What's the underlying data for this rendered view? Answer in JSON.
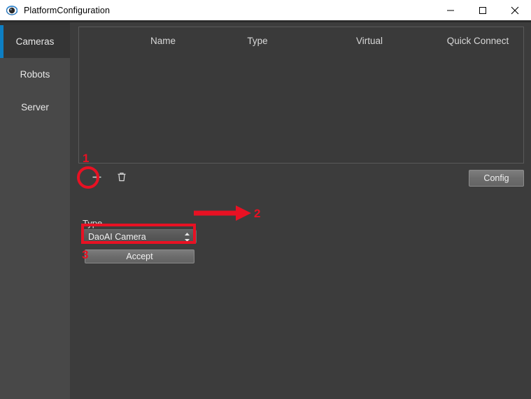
{
  "window": {
    "title": "PlatformConfiguration",
    "app_icon": "camera-eye-icon",
    "controls": {
      "minimize": "minimize-icon",
      "maximize": "maximize-icon",
      "close": "close-icon"
    }
  },
  "sidebar": {
    "items": [
      {
        "label": "Cameras",
        "selected": true
      },
      {
        "label": "Robots",
        "selected": false
      },
      {
        "label": "Server",
        "selected": false
      }
    ],
    "accent_color": "#0d7fc4"
  },
  "main": {
    "table": {
      "columns": [
        "Name",
        "Type",
        "Virtual",
        "Quick Connect"
      ],
      "rows": []
    },
    "toolbar": {
      "add_icon": "plus-icon",
      "delete_icon": "trash-icon",
      "config_label": "Config"
    },
    "type_group": {
      "label": "Type",
      "selected_value": "DaoAI Camera",
      "spinner_icon": "up-down-spinner-icon",
      "accept_label": "Accept"
    }
  },
  "annotations": {
    "color": "#e81123",
    "items": [
      {
        "number": "1",
        "target": "add-camera-button",
        "shape": "circle"
      },
      {
        "number": "2",
        "target": "type-select",
        "shape": "arrow"
      },
      {
        "number": "3",
        "target": "accept-button",
        "shape": "rectangle"
      }
    ]
  }
}
